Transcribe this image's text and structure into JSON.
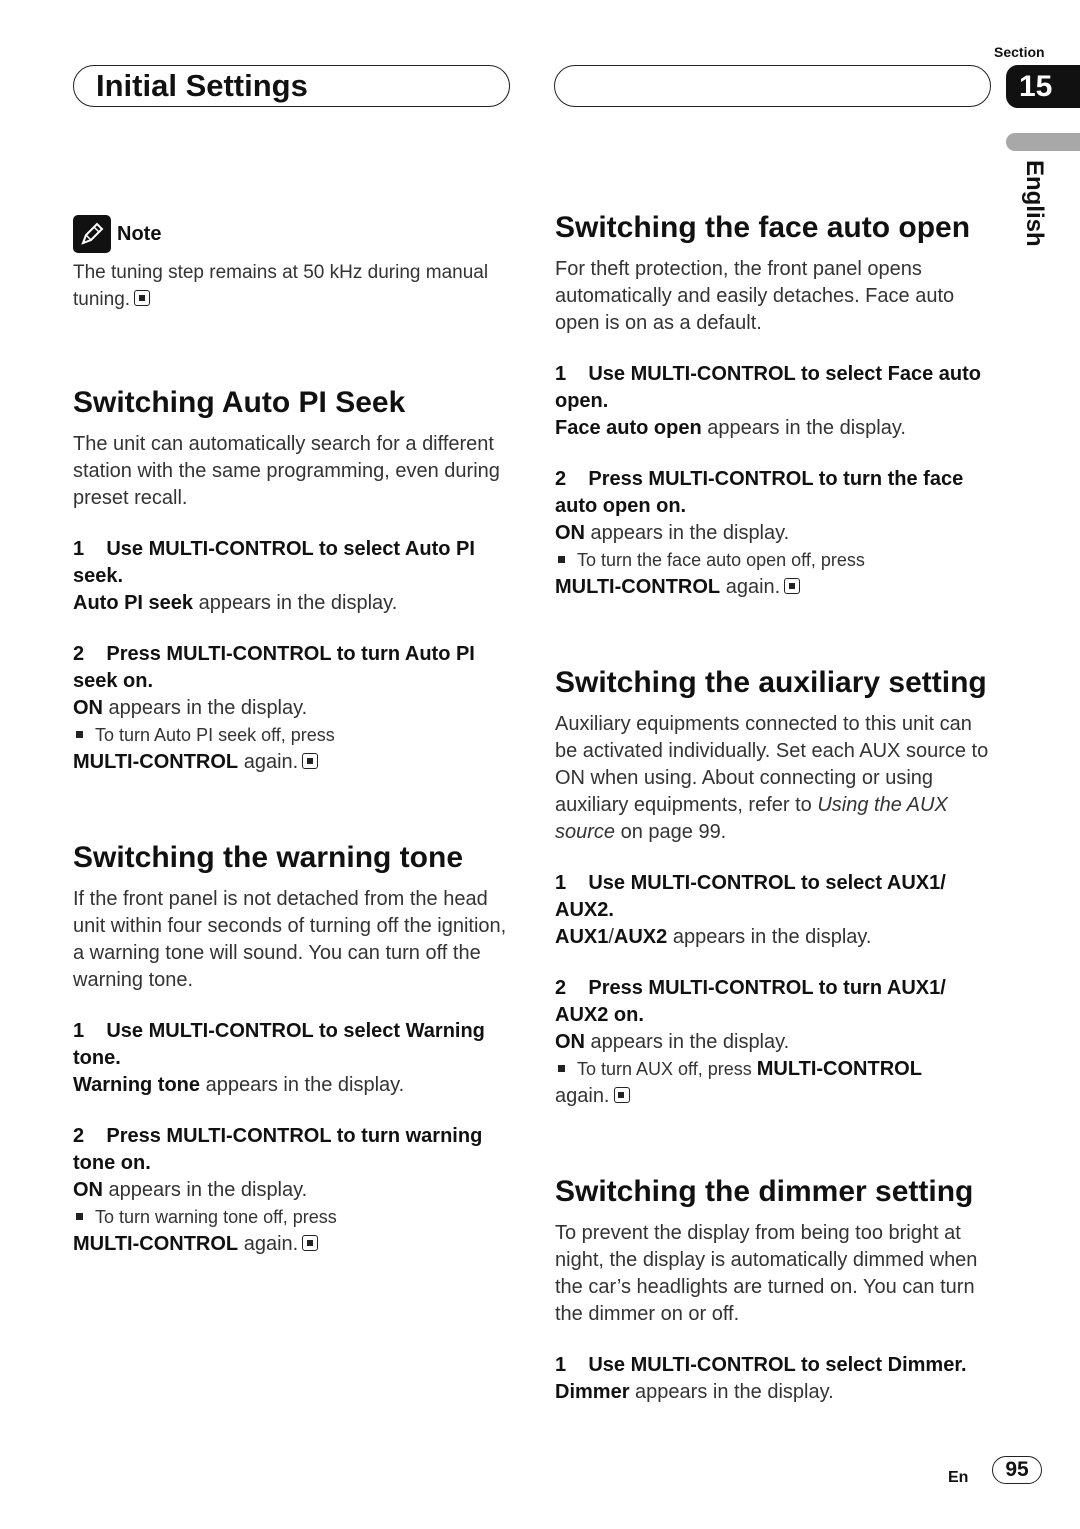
{
  "header": {
    "title": "Initial Settings",
    "section_label": "Section",
    "section_number": "15",
    "language": "English"
  },
  "note": {
    "label": "Note",
    "text": "The tuning step remains at 50 kHz during manual tuning."
  },
  "sections": {
    "auto_pi": {
      "title": "Switching Auto PI Seek",
      "intro": "The unit can automatically search for a different station with the same programming, even during preset recall.",
      "step1_num": "1",
      "step1_text": "Use MULTI-CONTROL to select Auto PI seek.",
      "step1_result_bold": "Auto PI seek",
      "step1_result_rest": " appears in the display.",
      "step2_num": "2",
      "step2_text": "Press MULTI-CONTROL to turn Auto PI seek on.",
      "step2_result_bold": "ON",
      "step2_result_rest": " appears in the display.",
      "bullet_text": "To turn Auto PI seek off, press",
      "bullet_bold": "MULTI-CONTROL",
      "bullet_rest": " again."
    },
    "warning_tone": {
      "title": "Switching the warning tone",
      "intro": "If the front panel is not detached from the head unit within four seconds of turning off the ignition, a warning tone will sound. You can turn off the warning tone.",
      "step1_num": "1",
      "step1_text": "Use MULTI-CONTROL to select Warning tone.",
      "step1_result_bold": "Warning tone",
      "step1_result_rest": " appears in the display.",
      "step2_num": "2",
      "step2_text": "Press MULTI-CONTROL to turn warning tone on.",
      "step2_result_bold": "ON",
      "step2_result_rest": " appears in the display.",
      "bullet_text": "To turn warning tone off, press",
      "bullet_bold": "MULTI-CONTROL",
      "bullet_rest": " again."
    },
    "face_auto_open": {
      "title": "Switching the face auto open",
      "intro": "For theft protection, the front panel opens automatically and easily detaches. Face auto open is on as a default.",
      "step1_num": "1",
      "step1_text": "Use MULTI-CONTROL to select Face auto open.",
      "step1_result_bold": "Face auto open",
      "step1_result_rest": " appears in the display.",
      "step2_num": "2",
      "step2_text": "Press MULTI-CONTROL to turn the face auto open on.",
      "step2_result_bold": "ON",
      "step2_result_rest": " appears in the display.",
      "bullet_text": "To turn the face auto open off, press",
      "bullet_bold": "MULTI-CONTROL",
      "bullet_rest": " again."
    },
    "auxiliary": {
      "title": "Switching the auxiliary setting",
      "intro_a": "Auxiliary equipments connected to this unit can be activated individually. Set each AUX source to ON when using. About connecting or using auxiliary equipments, refer to ",
      "intro_link": "Using the AUX source",
      "intro_b": " on page 99.",
      "step1_num": "1",
      "step1_text": "Use MULTI-CONTROL to select AUX1/ AUX2.",
      "step1_result_bold1": "AUX1",
      "step1_result_sep": "/",
      "step1_result_bold2": "AUX2",
      "step1_result_rest": " appears in the display.",
      "step2_num": "2",
      "step2_text": "Press MULTI-CONTROL to turn AUX1/ AUX2 on.",
      "step2_result_bold": "ON",
      "step2_result_rest": " appears in the display.",
      "bullet_text": "To turn AUX off, press ",
      "bullet_bold": "MULTI-CONTROL",
      "bullet_rest": " again."
    },
    "dimmer": {
      "title": "Switching the dimmer setting",
      "intro": "To prevent the display from being too bright at night, the display is automatically dimmed when the car’s headlights are turned on. You can turn the dimmer on or off.",
      "step1_num": "1",
      "step1_text": "Use MULTI-CONTROL to select Dimmer.",
      "step1_result_bold": "Dimmer",
      "step1_result_rest": " appears in the display."
    }
  },
  "footer": {
    "lang_code": "En",
    "page_number": "95"
  }
}
